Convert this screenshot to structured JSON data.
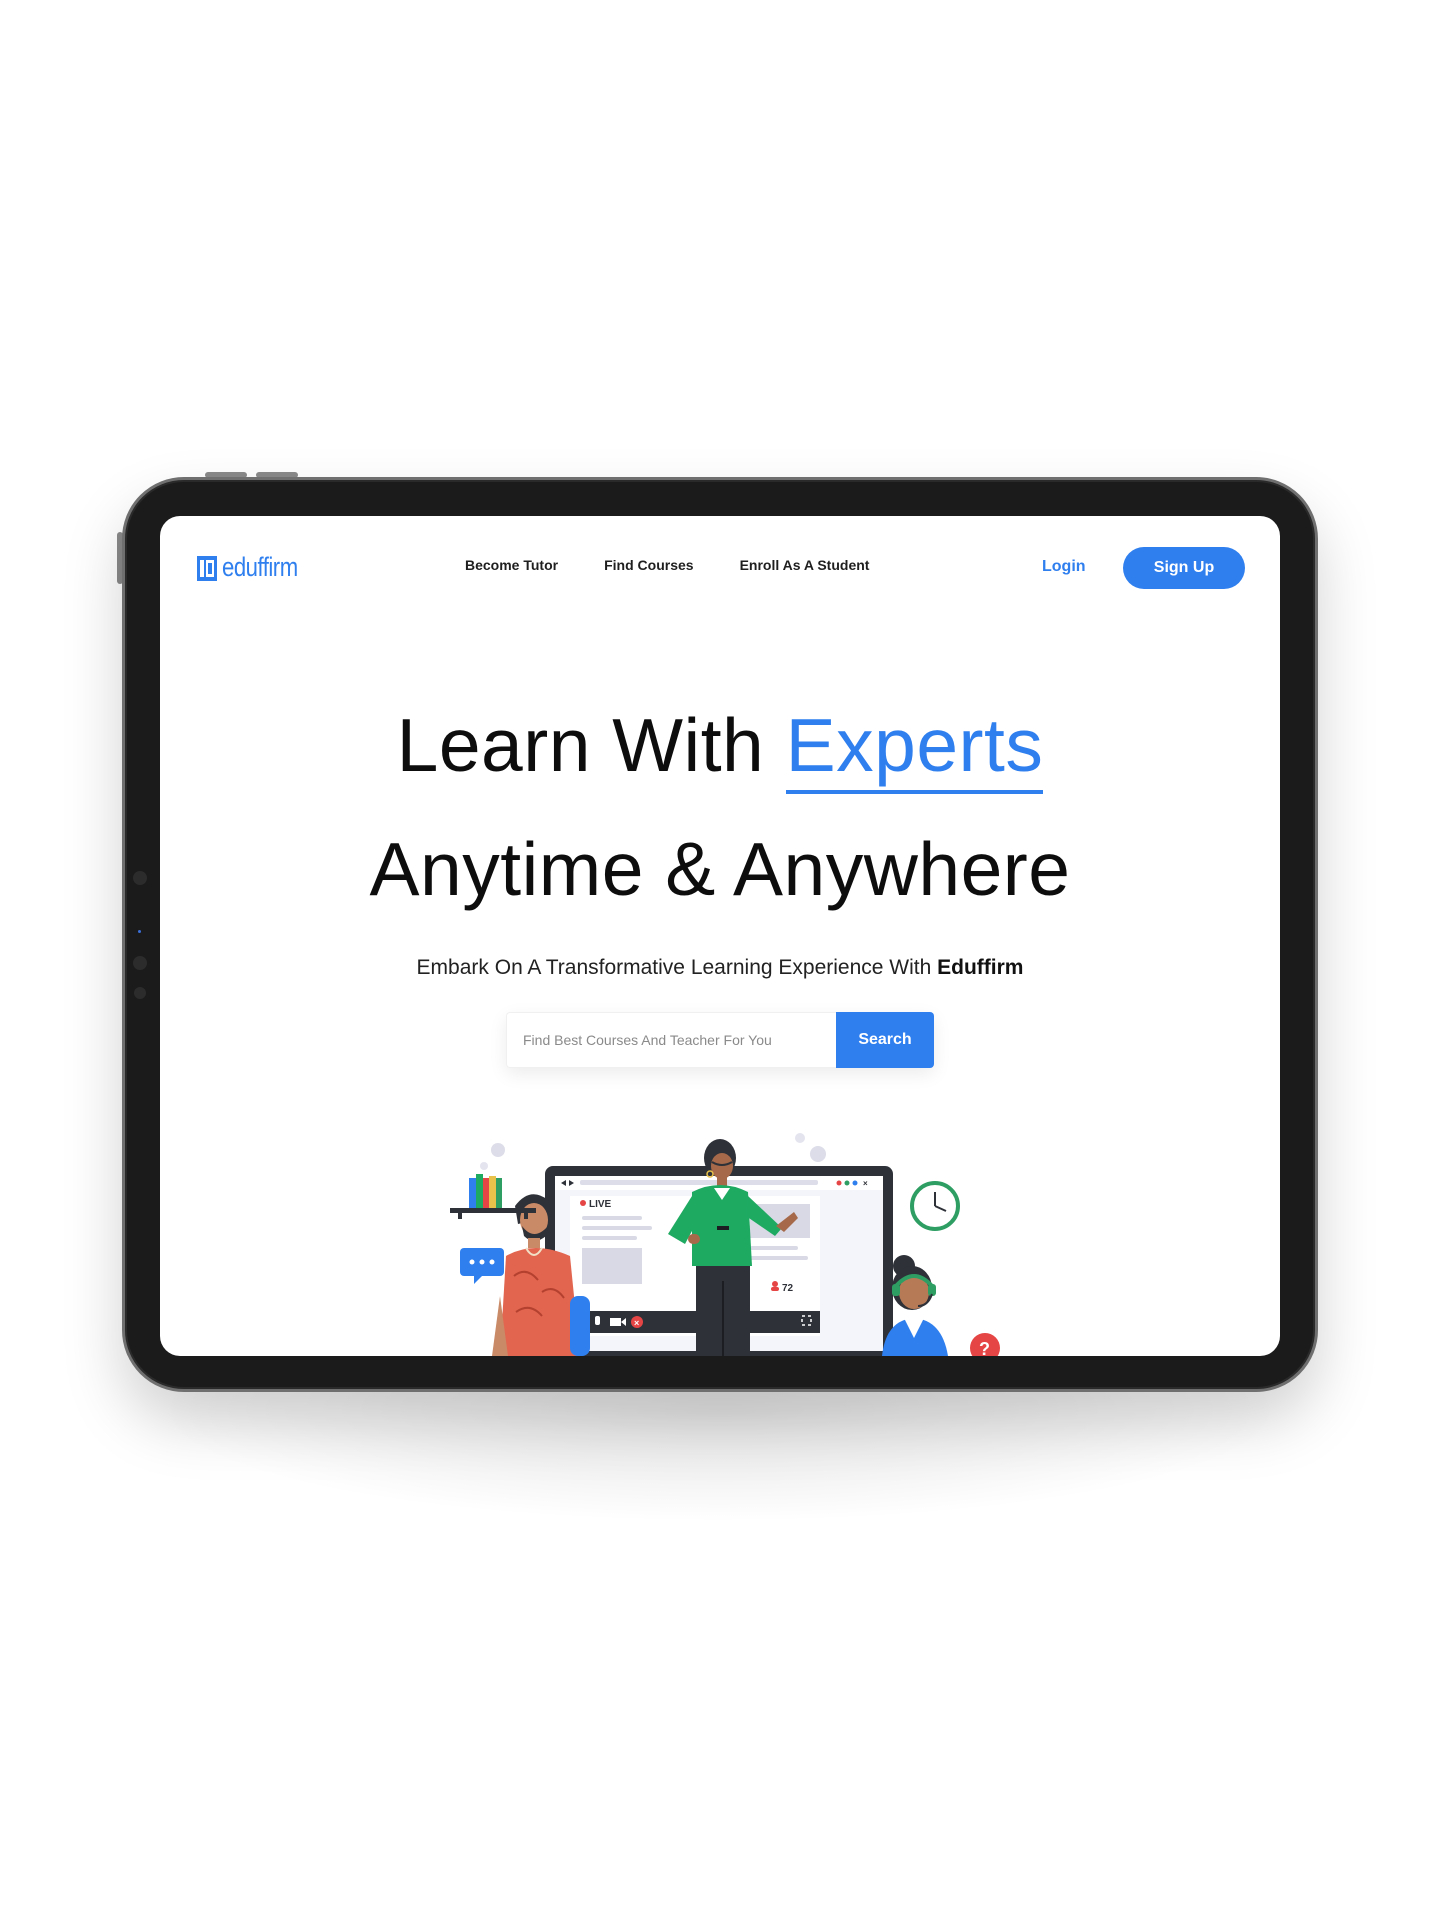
{
  "brand": {
    "name": "eduffirm",
    "accent_color": "#2f7fef"
  },
  "nav": {
    "links": [
      {
        "label": "Become Tutor"
      },
      {
        "label": "Find Courses"
      },
      {
        "label": "Enroll As A Student"
      }
    ],
    "login_label": "Login",
    "signup_label": "Sign Up"
  },
  "hero": {
    "line1_prefix": "Learn With ",
    "line1_accent": "Experts",
    "line2": "Anytime & Anywhere",
    "subtitle_prefix": "Embark On A Transformative Learning Experience With ",
    "subtitle_brand": "Eduffirm"
  },
  "search": {
    "placeholder": "Find Best Courses And Teacher For You",
    "button_label": "Search"
  },
  "illustration": {
    "live_label": "LIVE",
    "viewer_count": "72",
    "help_mark": "?",
    "icons": [
      "bookshelf-icon",
      "chat-bubble-icon",
      "clock-icon",
      "help-icon",
      "microphone-icon",
      "camera-icon",
      "close-icon",
      "fullscreen-icon",
      "user-icon"
    ]
  }
}
